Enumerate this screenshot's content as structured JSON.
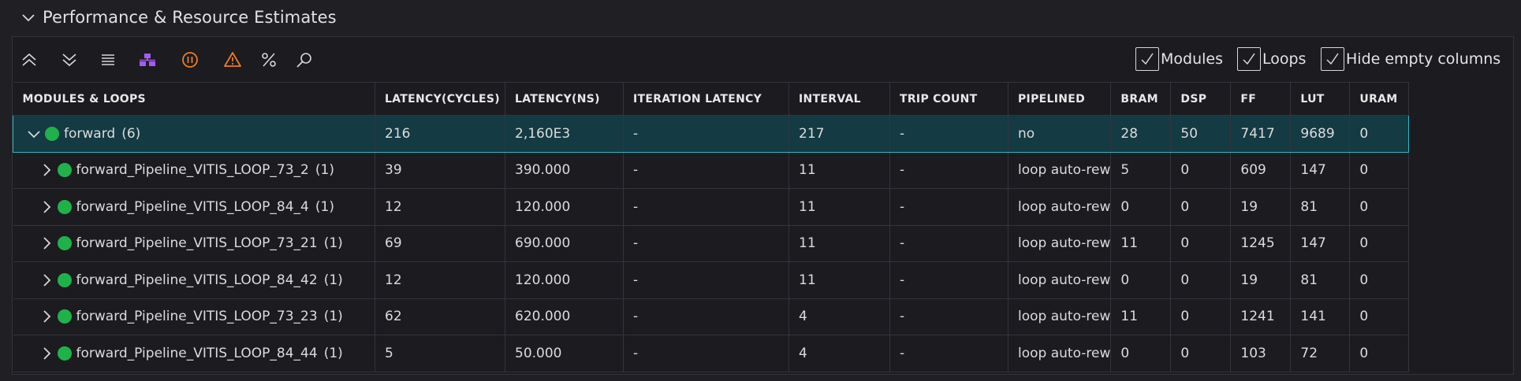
{
  "section": {
    "title": "Performance & Resource Estimates"
  },
  "toolbar": {
    "icons": [
      "collapse-all-icon",
      "expand-all-icon",
      "list-icon",
      "hierarchy-icon",
      "info-filter-icon",
      "warning-icon",
      "percent-icon",
      "search-icon"
    ],
    "colors": {
      "default": "#d8d8d8",
      "hierarchy": "#a55bf0",
      "info": "#f07d1e",
      "warning": "#f07d1e"
    },
    "options": {
      "modules": "Modules",
      "loops": "Loops",
      "hide_empty": "Hide empty columns"
    }
  },
  "table": {
    "headers": {
      "name": "MODULES & LOOPS",
      "latency_cycles": "LATENCY(CYCLES)",
      "latency_ns": "LATENCY(NS)",
      "iteration_latency": "ITERATION LATENCY",
      "interval": "INTERVAL",
      "trip_count": "TRIP COUNT",
      "pipelined": "PIPELINED",
      "bram": "BRAM",
      "dsp": "DSP",
      "ff": "FF",
      "lut": "LUT",
      "uram": "URAM"
    },
    "rows": [
      {
        "name": "forward",
        "count": "(6)",
        "latency_cycles": "216",
        "latency_ns": "2,160E3",
        "iteration_latency": "-",
        "interval": "217",
        "trip_count": "-",
        "pipelined": "no",
        "bram": "28",
        "dsp": "50",
        "ff": "7417",
        "lut": "9689",
        "uram": "0"
      },
      {
        "name": "forward_Pipeline_VITIS_LOOP_73_2",
        "count": "(1)",
        "latency_cycles": "39",
        "latency_ns": "390.000",
        "iteration_latency": "-",
        "interval": "11",
        "trip_count": "-",
        "pipelined": "loop auto-rew",
        "bram": "5",
        "dsp": "0",
        "ff": "609",
        "lut": "147",
        "uram": "0"
      },
      {
        "name": "forward_Pipeline_VITIS_LOOP_84_4",
        "count": "(1)",
        "latency_cycles": "12",
        "latency_ns": "120.000",
        "iteration_latency": "-",
        "interval": "11",
        "trip_count": "-",
        "pipelined": "loop auto-rew",
        "bram": "0",
        "dsp": "0",
        "ff": "19",
        "lut": "81",
        "uram": "0"
      },
      {
        "name": "forward_Pipeline_VITIS_LOOP_73_21",
        "count": "(1)",
        "latency_cycles": "69",
        "latency_ns": "690.000",
        "iteration_latency": "-",
        "interval": "11",
        "trip_count": "-",
        "pipelined": "loop auto-rew",
        "bram": "11",
        "dsp": "0",
        "ff": "1245",
        "lut": "147",
        "uram": "0"
      },
      {
        "name": "forward_Pipeline_VITIS_LOOP_84_42",
        "count": "(1)",
        "latency_cycles": "12",
        "latency_ns": "120.000",
        "iteration_latency": "-",
        "interval": "11",
        "trip_count": "-",
        "pipelined": "loop auto-rew",
        "bram": "0",
        "dsp": "0",
        "ff": "19",
        "lut": "81",
        "uram": "0"
      },
      {
        "name": "forward_Pipeline_VITIS_LOOP_73_23",
        "count": "(1)",
        "latency_cycles": "62",
        "latency_ns": "620.000",
        "iteration_latency": "-",
        "interval": "4",
        "trip_count": "-",
        "pipelined": "loop auto-rew",
        "bram": "11",
        "dsp": "0",
        "ff": "1241",
        "lut": "141",
        "uram": "0"
      },
      {
        "name": "forward_Pipeline_VITIS_LOOP_84_44",
        "count": "(1)",
        "latency_cycles": "5",
        "latency_ns": "50.000",
        "iteration_latency": "-",
        "interval": "4",
        "trip_count": "-",
        "pipelined": "loop auto-rew",
        "bram": "0",
        "dsp": "0",
        "ff": "103",
        "lut": "72",
        "uram": "0"
      }
    ]
  },
  "colors": {
    "status_ok": "#1fb24a",
    "selection": "#143a44",
    "selection_border": "#2fb6c6"
  }
}
